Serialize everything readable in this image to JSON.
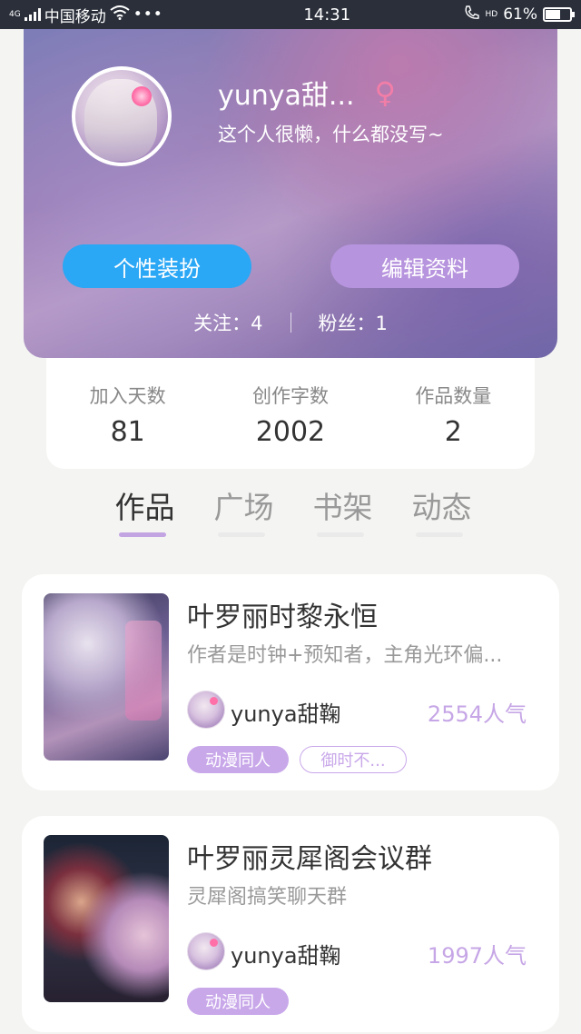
{
  "status_bar": {
    "network": "4G",
    "carrier": "中国移动",
    "time": "14:31",
    "hd_label": "HD",
    "battery_percent_text": "61%",
    "battery_level": 0.61,
    "icons": [
      "signal-icon",
      "wifi-icon",
      "more-dots-icon",
      "call-icon",
      "battery-icon"
    ]
  },
  "profile": {
    "username": "yunya甜...",
    "gender_symbol": "♀",
    "bio": "这个人很懒，什么都没写~",
    "buttons": {
      "dress_up": "个性装扮",
      "edit_profile": "编辑资料"
    },
    "following": "关注：4",
    "followers": "粉丝：1",
    "colors": {
      "dress_button": "#2aa7f5",
      "edit_button": "#b794de",
      "gender": "#f27ea7"
    }
  },
  "stats": [
    {
      "label": "加入天数",
      "value": "81"
    },
    {
      "label": "创作字数",
      "value": "2002"
    },
    {
      "label": "作品数量",
      "value": "2"
    }
  ],
  "tabs": [
    {
      "label": "作品",
      "active": true
    },
    {
      "label": "广场",
      "active": false
    },
    {
      "label": "书架",
      "active": false
    },
    {
      "label": "动态",
      "active": false
    }
  ],
  "works": [
    {
      "title": "叶罗丽时黎永恒",
      "description": "作者是时钟+预知者，主角光环偏...",
      "author": "yunya甜鞠",
      "popularity": "2554人气",
      "tags": [
        "动漫同人",
        "御时不..."
      ]
    },
    {
      "title": "叶罗丽灵犀阁会议群",
      "description": "灵犀阁搞笑聊天群",
      "author": "yunya甜鞠",
      "popularity": "1997人气",
      "tags": [
        "动漫同人"
      ]
    }
  ],
  "accent_color": "#c9a8ea"
}
